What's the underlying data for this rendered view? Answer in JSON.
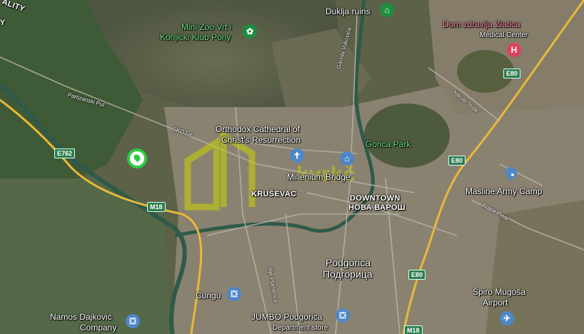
{
  "map": {
    "top_left_fragment": "ALITY",
    "roads": {
      "partizanski_put": "Partizanski Put",
      "skoja": "SKOJ-a",
      "gavrila_vukovica": "Gavrila Vukovića",
      "nikole_tesle": "Nikole Tesle",
      "ilije_plamenca": "Ilije Plamenca",
      "brace_pioar": "Braće Pioar"
    },
    "shields": {
      "e762": "E762",
      "m18_west": "M18",
      "e80_north": "E80",
      "e80_middle": "E80",
      "e80_south": "E80",
      "m18_south": "M18"
    },
    "places": {
      "dukljа_ruins": "Duklja ruins",
      "mini_zoo_line1": "Mini Zoo Vrt i",
      "mini_zoo_line2": "Konjicki Klub Pony",
      "dom_zdravlja": "Dom zdravlja Zlatica",
      "medical_center": "Medical Center",
      "orthodox_line1": "Orthodox Cathedral of",
      "orthodox_line2": "Christ's Resurrection",
      "gorica_park": "Gorica Park",
      "millenium_bridge": "Millenium Bridge",
      "krusevac": "KRUŠEVAC",
      "downtown_line1": "DOWNTOWN",
      "downtown_line2": "НОВА ВАРОШ",
      "masline": "Masline Army Camp",
      "podgorica_latin": "Podgorica",
      "podgorica_cyrillic": "Подгорица",
      "cungu": "Cungu",
      "namos_line1": "Namos Dajković",
      "namos_line2": "Company",
      "jumbo": "JUMBO Podgorica",
      "department_store": "Department store",
      "spiro_line1": "Špiro Mugoša",
      "spiro_line2": "Airport"
    },
    "watermark_text": "kvrkč",
    "colors": {
      "place_green": "#6fe08a",
      "place_pink": "#ff8fa8",
      "marker_green": "#2ecc40",
      "road_yellow": "#e8b83a",
      "river": "#2f5a4a",
      "watermark": "#c8d400"
    },
    "icons": [
      "museum-icon",
      "paw-icon",
      "hospital-icon",
      "church-icon",
      "landmark-icon",
      "shopping-bag-icon",
      "airport-icon",
      "location-pin-icon"
    ]
  }
}
